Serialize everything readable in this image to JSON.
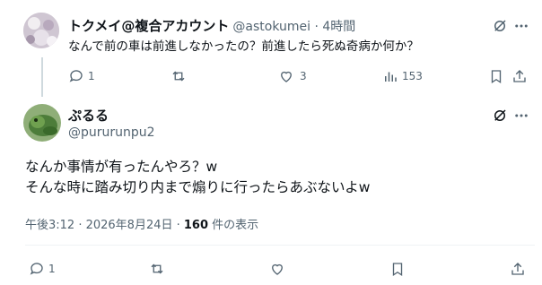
{
  "reply": {
    "display_name": "トクメイ@複合アカウント",
    "handle_time": "@astokumei · 4時間",
    "text": "なんで前の車は前進しなかったの？前進したら死ぬ奇病か何か？",
    "replies": "1",
    "retweets": "",
    "likes": "3",
    "views": "153"
  },
  "main": {
    "display_name": "ぷるる",
    "handle": "@pururunpu2",
    "text_line1": "なんか事情が有ったんやろ？w",
    "text_line2": "そんな時に踏み切り内まで煽りに行ったらあぶないよw",
    "timestamp": "午後3:12 · 2026年8月24日 · ",
    "views_count": "160",
    "views_label": " 件の表示",
    "replies": "1"
  }
}
